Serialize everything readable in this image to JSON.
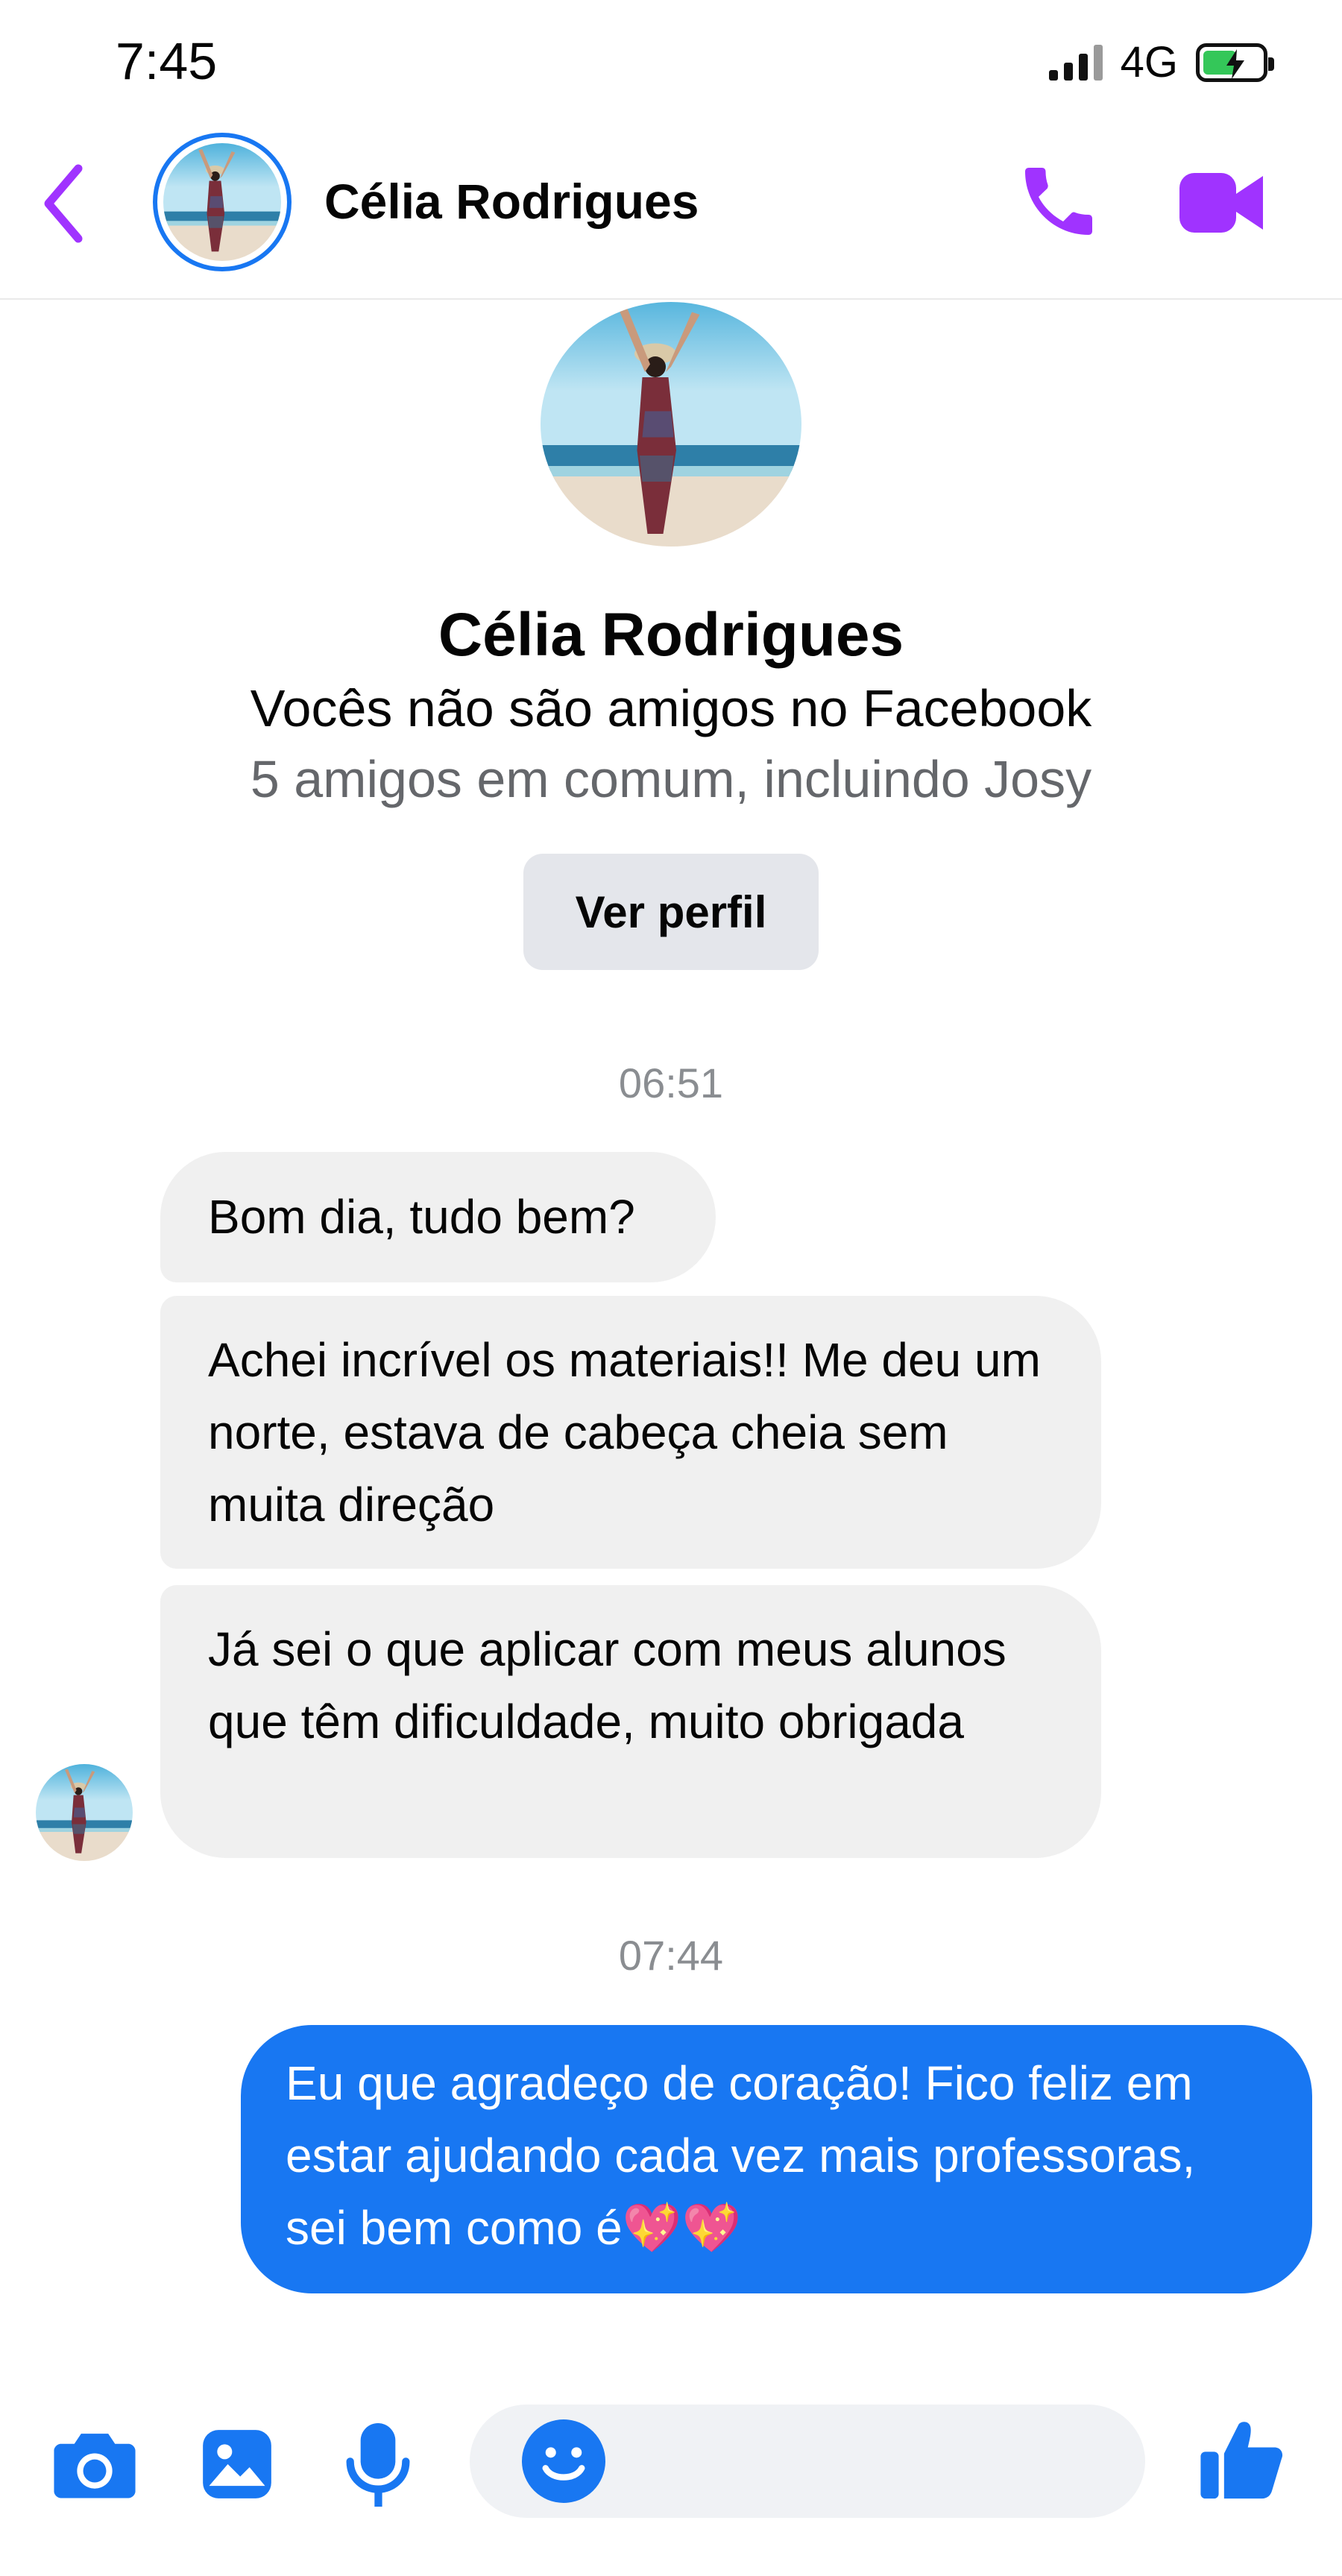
{
  "status_bar": {
    "time": "7:45",
    "network": "4G"
  },
  "header": {
    "contact_name": "Célia Rodrigues"
  },
  "profile": {
    "name": "Célia Rodrigues",
    "relationship": "Vocês não são amigos no Facebook",
    "mutual_friends": "5 amigos em comum, incluindo Josy",
    "view_profile_label": "Ver perfil"
  },
  "conversation": {
    "timestamp_1": "06:51",
    "incoming": [
      "Bom dia, tudo bem?",
      "Achei incrível os materiais!! Me deu um norte, estava de cabeça cheia sem muita direção",
      "Já sei o que aplicar com meus alunos que têm dificuldade, muito obrigada"
    ],
    "timestamp_2": "07:44",
    "outgoing": [
      "Eu que agradeço de coração! Fico feliz em estar ajudando cada vez mais professoras, sei bem como é💖💖"
    ]
  },
  "colors": {
    "accent_purple": "#a033ff",
    "messenger_blue": "#1877f2",
    "incoming_bubble": "#f0f0f0",
    "battery_green": "#34c759"
  },
  "icons": [
    "back-chevron-icon",
    "phone-icon",
    "video-camera-icon",
    "camera-icon",
    "gallery-icon",
    "microphone-icon",
    "emoji-icon",
    "thumbs-up-icon"
  ]
}
